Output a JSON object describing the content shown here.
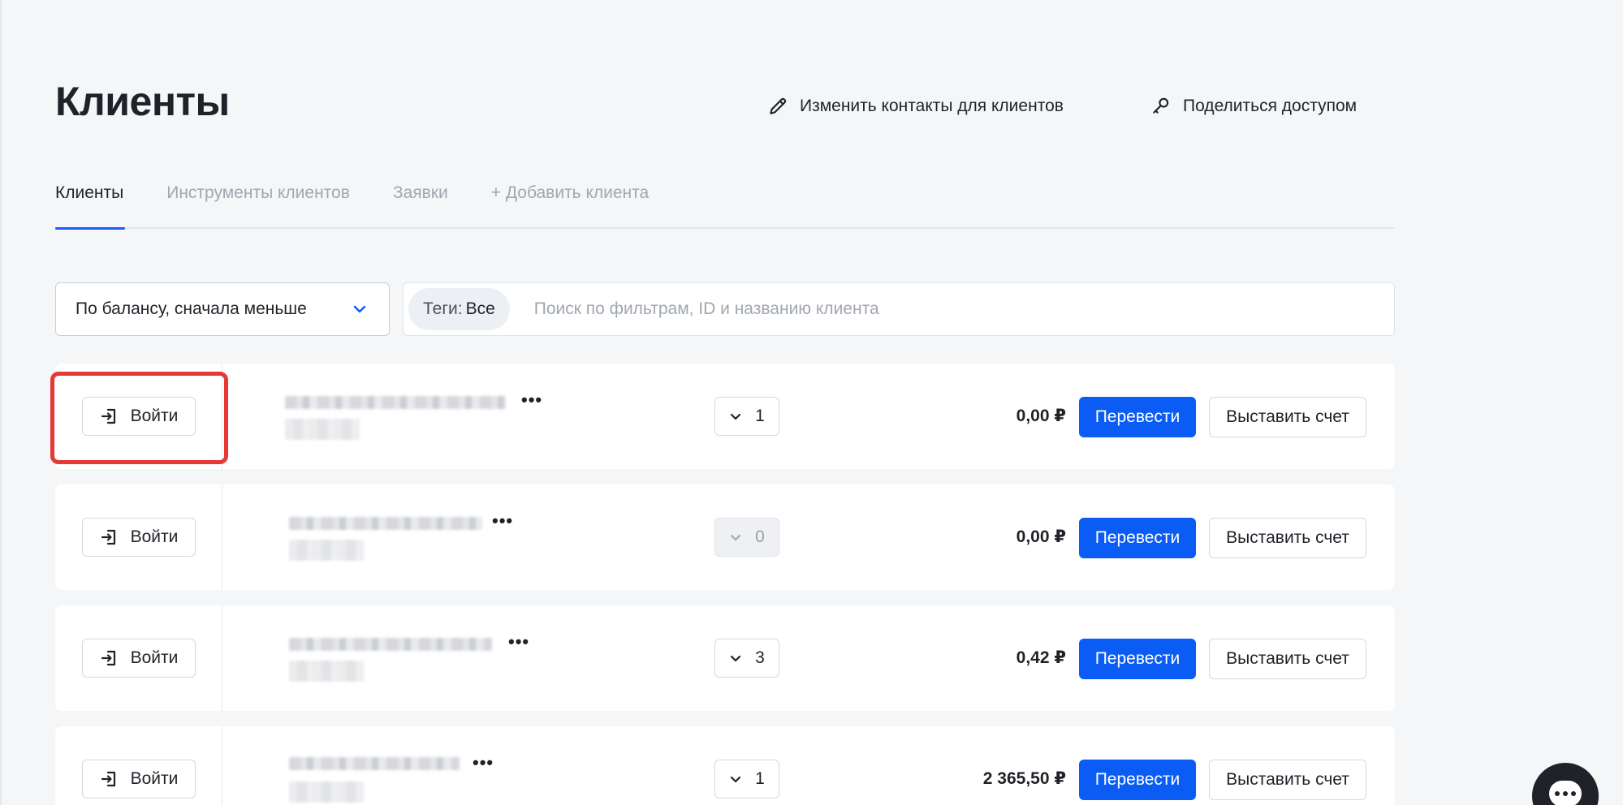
{
  "header": {
    "title": "Клиенты",
    "edit_contacts_label": "Изменить контакты для клиентов",
    "share_access_label": "Поделиться доступом"
  },
  "tabs": [
    {
      "label": "Клиенты",
      "active": true
    },
    {
      "label": "Инструменты клиентов",
      "active": false
    },
    {
      "label": "Заявки",
      "active": false
    },
    {
      "label": "+ Добавить клиента",
      "active": false
    }
  ],
  "filters": {
    "sort_value": "По балансу, сначала меньше",
    "tag_label": "Теги:",
    "tag_value": "Все",
    "search_placeholder": "Поиск по фильтрам, ID и названию клиента"
  },
  "rows": [
    {
      "login_label": "Войти",
      "count": "1",
      "count_disabled": false,
      "balance": "0,00 ₽",
      "transfer_label": "Перевести",
      "invoice_label": "Выставить счет"
    },
    {
      "login_label": "Войти",
      "count": "0",
      "count_disabled": true,
      "balance": "0,00 ₽",
      "transfer_label": "Перевести",
      "invoice_label": "Выставить счет"
    },
    {
      "login_label": "Войти",
      "count": "3",
      "count_disabled": false,
      "balance": "0,42 ₽",
      "transfer_label": "Перевести",
      "invoice_label": "Выставить счет"
    },
    {
      "login_label": "Войти",
      "count": "1",
      "count_disabled": false,
      "balance": "2 365,50 ₽",
      "transfer_label": "Перевести",
      "invoice_label": "Выставить счет"
    }
  ],
  "colors": {
    "accent": "#0a5cf5",
    "highlight": "#e53935"
  },
  "icons": {
    "edit": "pencil-icon",
    "share": "key-icon",
    "login": "login-icon",
    "chevron": "chevron-down-icon",
    "chat": "chat-icon"
  }
}
